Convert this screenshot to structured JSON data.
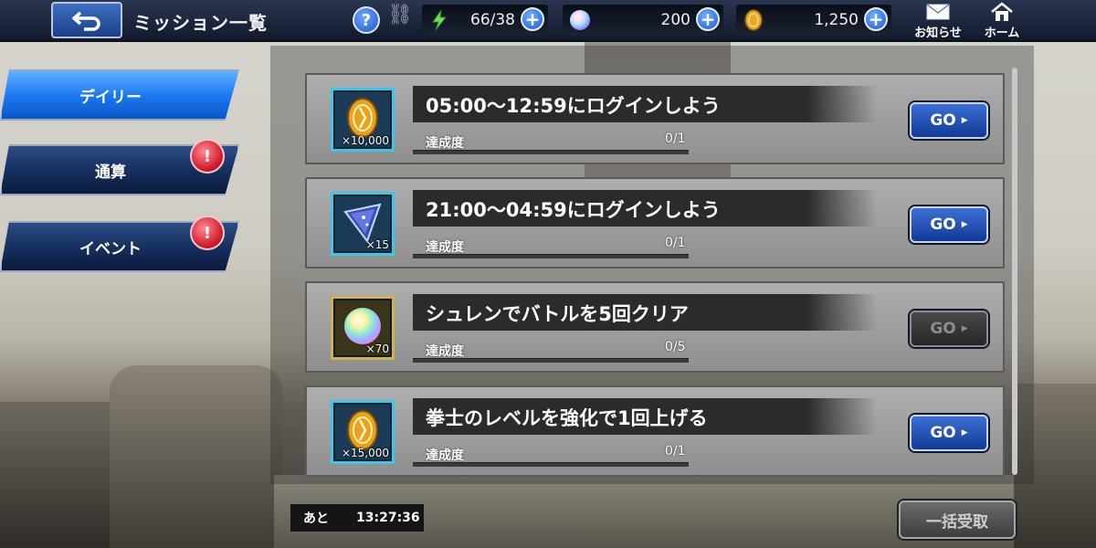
{
  "header": {
    "title": "ミッション一覧",
    "help_label": "?",
    "stamina": "66/38",
    "gems": "200",
    "gil": "1,250",
    "plus_label": "+",
    "mail_label": "お知らせ",
    "home_label": "ホーム"
  },
  "tabs": [
    {
      "label": "デイリー",
      "active": true
    },
    {
      "label": "通算",
      "alert": true
    },
    {
      "label": "イベント",
      "alert": true
    }
  ],
  "alert_symbol": "!",
  "missions": [
    {
      "reward_icon": "gil-coin-icon",
      "reward_qty": "×10,000",
      "description": "05:00～12:59にログインしよう",
      "progress_label": "達成度",
      "progress": "0/1",
      "progress_fraction": 0,
      "button_label": "GO",
      "button_enabled": true
    },
    {
      "reward_icon": "crystal-shard-icon",
      "reward_qty": "×15",
      "description": "21:00～04:59にログインしよう",
      "progress_label": "達成度",
      "progress": "0/1",
      "progress_fraction": 0,
      "button_label": "GO",
      "button_enabled": true
    },
    {
      "reward_icon": "gem-orb-icon",
      "reward_qty": "×70",
      "description": "シュレンでバトルを5回クリア",
      "progress_label": "達成度",
      "progress": "0/5",
      "progress_fraction": 0,
      "button_label": "GO",
      "button_enabled": false
    },
    {
      "reward_icon": "gil-coin-icon",
      "reward_qty": "×15,000",
      "description": "拳士のレベルを強化で1回上げる",
      "progress_label": "達成度",
      "progress": "0/1",
      "progress_fraction": 0,
      "button_label": "GO",
      "button_enabled": true
    }
  ],
  "footer": {
    "timer_label": "あと",
    "timer_value": "13:27:36",
    "bulk_button_label": "一括受取"
  },
  "colors": {
    "accent_blue": "#1d7af0",
    "alert_red": "#d21b2c",
    "panel_gray": "#9f9f9f"
  }
}
